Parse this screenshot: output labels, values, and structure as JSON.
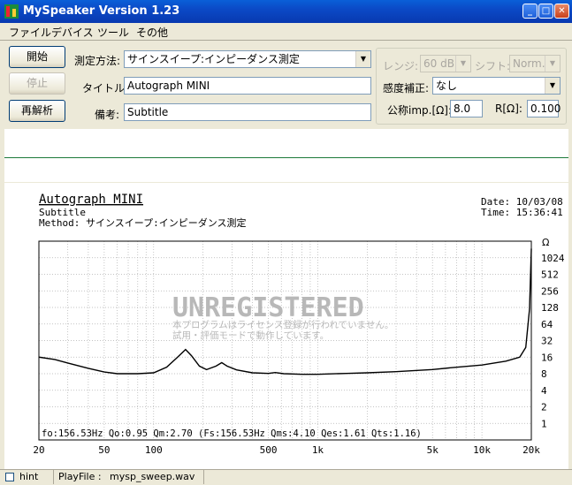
{
  "window": {
    "title": "MySpeaker Version 1.23"
  },
  "menu": [
    "ファイル",
    "デバイス",
    "ツール",
    "その他"
  ],
  "buttons": {
    "start": "開始",
    "stop": "停止",
    "reanalyze": "再解析"
  },
  "form": {
    "method_label": "測定方法:",
    "method_value": "サインスイープ:インピーダンス測定",
    "title_label": "タイトル:",
    "title_value": "Autograph MINI",
    "memo_label": "備考:",
    "memo_value": "Subtitle"
  },
  "settings": {
    "range_label": "レンジ:",
    "range_value": "60 dB",
    "shift_label": "シフト:",
    "shift_value": "Norm.",
    "sensitivity_label": "感度補正:",
    "sensitivity_value": "なし",
    "nominal_label": "公称imp.[Ω]:",
    "nominal_value": "8.0",
    "r_label": "R[Ω]:",
    "r_value": "0.100"
  },
  "graph": {
    "title": "Autograph MINI",
    "subtitle": "Subtitle",
    "method": "Method: サインスイープ:インピーダンス測定",
    "date": "Date: 10/03/08",
    "time": "Time: 15:36:41",
    "watermark": "UNREGISTERED",
    "watermark_line1": "本プログラムはライセンス登録が行われていません。",
    "watermark_line2": "試用・評価モードで動作しています。",
    "params": "fo:156.53Hz  Qo:0.95 Qm:2.70 (Fs:156.53Hz  Qms:4.10 Qes:1.61 Qts:1.16)",
    "unit": "Ω"
  },
  "chart_data": {
    "type": "line",
    "x_scale": "log",
    "y_scale": "log2",
    "xlim": [
      20,
      20000
    ],
    "ylim": [
      0.5,
      2048
    ],
    "y_unit": "Ω",
    "x_ticks": [
      "20",
      "50",
      "100",
      "500",
      "1k",
      "5k",
      "10k",
      "20k"
    ],
    "x_tick_values": [
      20,
      50,
      100,
      500,
      1000,
      5000,
      10000,
      20000
    ],
    "y_ticks": [
      "1024",
      "512",
      "256",
      "128",
      "64",
      "32",
      "16",
      "8",
      "4",
      "2",
      "1"
    ],
    "y_tick_values": [
      1024,
      512,
      256,
      128,
      64,
      32,
      16,
      8,
      4,
      2,
      1
    ],
    "series": [
      {
        "color": "#000000",
        "points": [
          [
            20,
            16
          ],
          [
            25,
            14.5
          ],
          [
            30,
            12.5
          ],
          [
            40,
            10
          ],
          [
            50,
            8.6
          ],
          [
            60,
            8
          ],
          [
            80,
            8
          ],
          [
            100,
            8.3
          ],
          [
            120,
            10.5
          ],
          [
            140,
            16
          ],
          [
            156.5,
            22
          ],
          [
            170,
            17
          ],
          [
            190,
            11
          ],
          [
            210,
            9.5
          ],
          [
            240,
            11
          ],
          [
            260,
            12.7
          ],
          [
            280,
            11
          ],
          [
            320,
            9.4
          ],
          [
            400,
            8.3
          ],
          [
            500,
            8.1
          ],
          [
            550,
            8.4
          ],
          [
            620,
            8
          ],
          [
            800,
            7.8
          ],
          [
            1000,
            7.8
          ],
          [
            1500,
            8.1
          ],
          [
            2000,
            8.3
          ],
          [
            3000,
            8.7
          ],
          [
            5000,
            9.5
          ],
          [
            7000,
            10.5
          ],
          [
            10000,
            11.5
          ],
          [
            14000,
            13.5
          ],
          [
            17000,
            16
          ],
          [
            18500,
            24
          ],
          [
            19500,
            120
          ],
          [
            20000,
            1500
          ]
        ]
      }
    ]
  },
  "status": {
    "hint": "hint",
    "playfile_label": "PlayFile :",
    "playfile_value": "mysp_sweep.wav"
  },
  "colors": {
    "titlebar": "#0b49c6",
    "divider": "#1c7a3a",
    "watermark": "#b8b8b8"
  }
}
